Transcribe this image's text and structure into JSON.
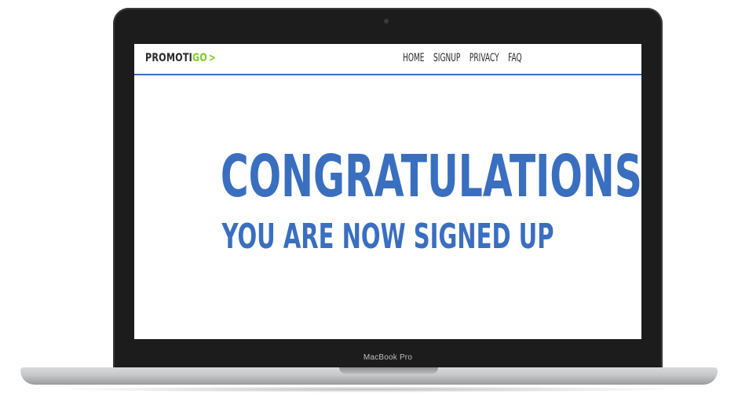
{
  "device": {
    "label": "MacBook Pro"
  },
  "site": {
    "logo": {
      "prefix": "PROMOTI",
      "accent": "GO",
      "arrow": ">"
    },
    "nav": [
      {
        "label": "HOME"
      },
      {
        "label": "SIGNUP"
      },
      {
        "label": "PRIVACY"
      },
      {
        "label": "FAQ"
      }
    ],
    "headline": "CONGRATULATIONS",
    "subline": "YOU ARE NOW SIGNED UP"
  },
  "colors": {
    "brand_blue": "#3a6fbf",
    "brand_green": "#7ccf2a",
    "bezel": "#1c1c1c"
  }
}
